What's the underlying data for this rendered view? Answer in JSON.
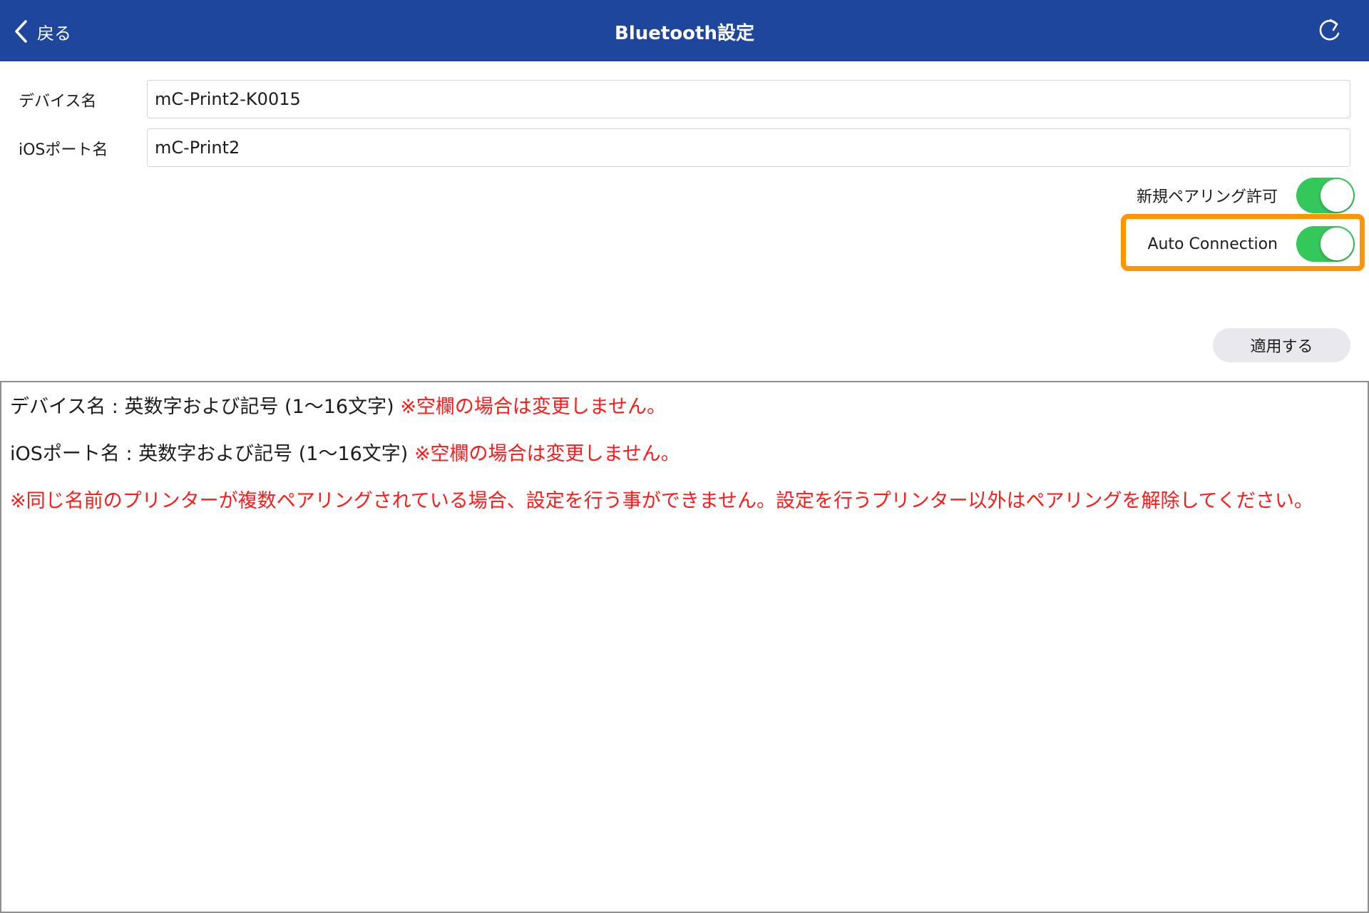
{
  "nav": {
    "back_label": "戻る",
    "title": "Bluetooth設定"
  },
  "form": {
    "device_name": {
      "label": "デバイス名",
      "value": "mC-Print2-K0015"
    },
    "ios_port_name": {
      "label": "iOSポート名",
      "value": "mC-Print2"
    },
    "new_pairing": {
      "label": "新規ペアリング許可",
      "enabled": true
    },
    "auto_connection": {
      "label": "Auto Connection",
      "enabled": true
    },
    "apply_label": "適用する"
  },
  "info": {
    "device_name_rule": "デバイス名 : 英数字および記号 (1～16文字)",
    "device_name_note": "※空欄の場合は変更しません。",
    "ios_port_rule": "iOSポート名 : 英数字および記号 (1～16文字)",
    "ios_port_note": "※空欄の場合は変更しません。",
    "duplicate_warning": "※同じ名前のプリンターが複数ペアリングされている場合、設定を行う事ができません。設定を行うプリンター以外はペアリングを解除してください。"
  },
  "colors": {
    "nav_background": "#1f469d",
    "toggle_on": "#34c759",
    "highlight": "#ff9500",
    "warning_text": "#ff1a1a"
  }
}
